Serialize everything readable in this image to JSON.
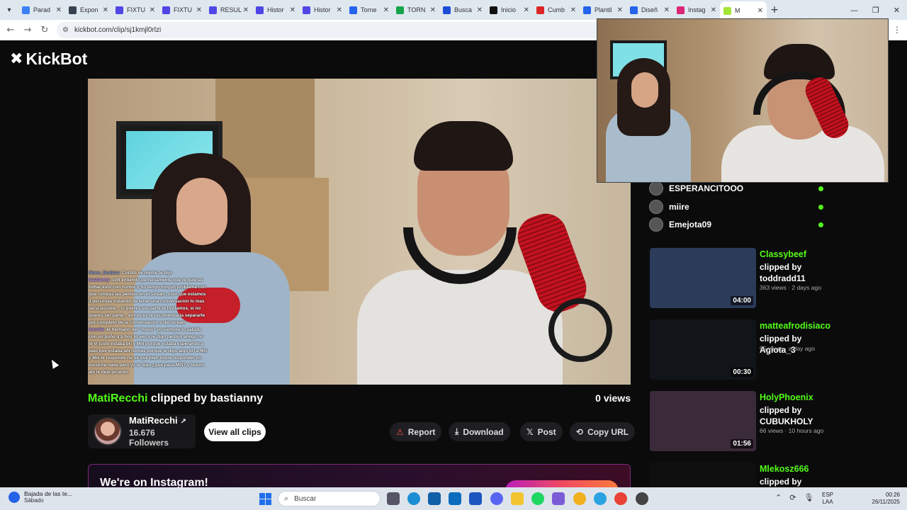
{
  "browser": {
    "tabs": [
      {
        "label": "Parad",
        "color": "#3b82f6"
      },
      {
        "label": "Expon",
        "color": "#374151"
      },
      {
        "label": "FIXTU",
        "color": "#4f46e5"
      },
      {
        "label": "FIXTU",
        "color": "#4f46e5"
      },
      {
        "label": "RESUL",
        "color": "#4f46e5"
      },
      {
        "label": "Histor",
        "color": "#4f46e5"
      },
      {
        "label": "Histor",
        "color": "#4f46e5"
      },
      {
        "label": "Torne",
        "color": "#2563eb"
      },
      {
        "label": "TORN",
        "color": "#16a34a"
      },
      {
        "label": "Busca",
        "color": "#1d4ed8"
      },
      {
        "label": "Inicio",
        "color": "#111111"
      },
      {
        "label": "Cumb",
        "color": "#dc2626"
      },
      {
        "label": "Plantil",
        "color": "#2563eb"
      },
      {
        "label": "Diseñ",
        "color": "#2563eb"
      },
      {
        "label": "Instag",
        "color": "#db2777"
      },
      {
        "label": "M",
        "color": "#a3e635"
      }
    ],
    "url": "kickbot.com/clip/sj1kmjl0rlzi"
  },
  "site": {
    "logo": "KickBot"
  },
  "chat_overlay": [
    {
      "user": "Mono_Budista",
      "text": ": Cortito de mente te dijo"
    },
    {
      "user": "bastianny",
      "text": ": sofi entiendo perfectamente que te quieras tomar esto con humor y no tengo ningun problema con que rompas las pelotas en el stream, creo que estamos 3 personas tratando de tener una conversacion lo mas seria posible... si queres ser parte te invitamos, si no queres ser parte... entonces te recomendaria separarte por completo de la conversacion o del stream"
    },
    {
      "user": "luccola",
      "text": ": el hermano del \"novio\" yo siempre lo saludo con un puño q p hoy lo veo y le digo perdón amigo no te vi justo estaba bri y Mili porque estaba esperando a palo que estaba ahí nomás porque le digo algo bri a Mili y Mili le responde no sé qué bien loque responder no escuché nada pero yo le digo ¿qué pasa Mili? y bueno ahí le dejé picando"
    }
  ],
  "clip": {
    "streamer": "MatiRecchi",
    "clipped_text": "clipped by bastianny",
    "views": "0 views"
  },
  "channel": {
    "name": "MatiRecchi",
    "followers": "16.676 Followers",
    "all_clips": "View all clips"
  },
  "actions": {
    "report": "Report",
    "download": "Download",
    "post": "Post",
    "copy_url": "Copy URL"
  },
  "promo": {
    "title": "We're on Instagram!"
  },
  "viewers": [
    {
      "name": "ESPERANCITOOO"
    },
    {
      "name": "miire"
    },
    {
      "name": "Emejota09"
    }
  ],
  "related_clips": [
    {
      "channel": "Classybeef",
      "by": "clipped by toddradd11",
      "meta": "363 views · 2 days ago",
      "duration": "04:00",
      "thumb": "#2b3b5a"
    },
    {
      "channel": "matteafrodisiaco",
      "by": "clipped by Agiota_3",
      "meta": "95 views · a day ago",
      "duration": "00:30",
      "thumb": "#111418"
    },
    {
      "channel": "HolyPhoenix",
      "by": "clipped by CUBUKHOLY",
      "meta": "66 views · 10 hours ago",
      "duration": "01:56",
      "thumb": "#3a2a3a"
    },
    {
      "channel": "Mlekosz666",
      "by": "clipped by",
      "meta": "",
      "duration": "",
      "thumb": "#0f0f10"
    }
  ],
  "taskbar": {
    "news_title": "Bajada de las te...",
    "news_sub": "Sábado",
    "search_placeholder": "Buscar",
    "lang_1": "ESP",
    "lang_2": "LAA",
    "time": "00:26",
    "date": "26/11/2025"
  }
}
